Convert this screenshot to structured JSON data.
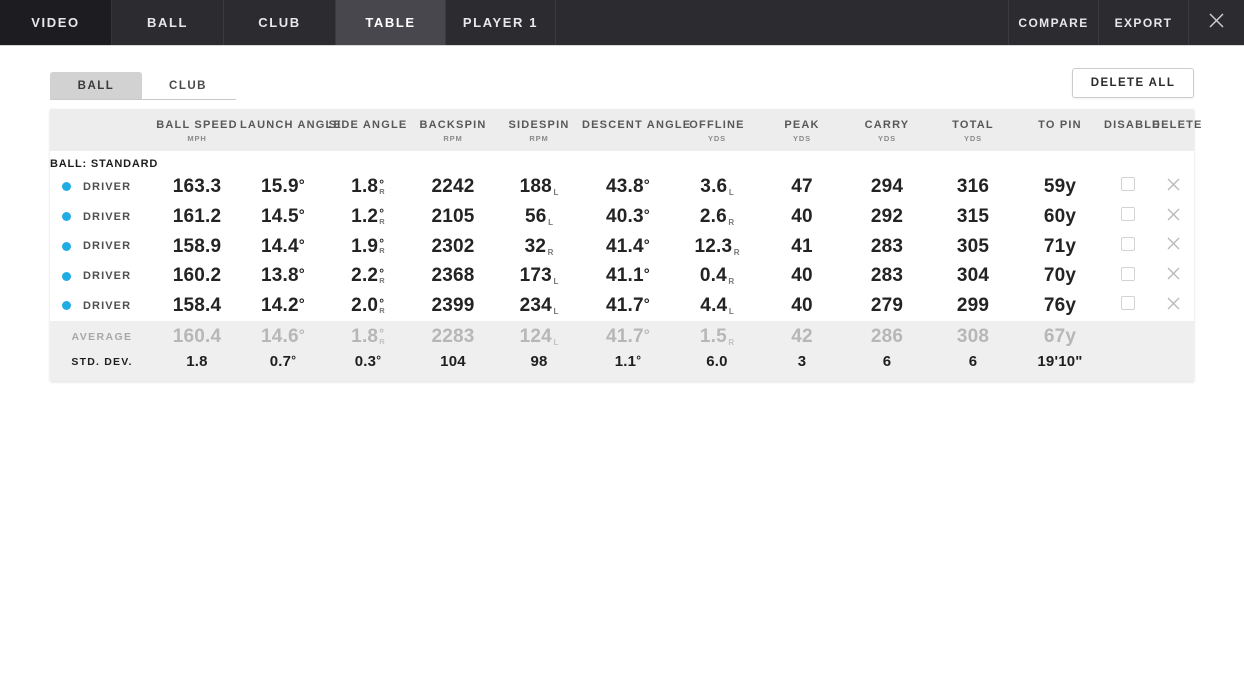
{
  "topnav": {
    "tabs": [
      {
        "label": "VIDEO",
        "active": false
      },
      {
        "label": "BALL",
        "active": false
      },
      {
        "label": "CLUB",
        "active": false
      },
      {
        "label": "TABLE",
        "active": true
      },
      {
        "label": "PLAYER 1",
        "active": false
      }
    ],
    "compare_label": "COMPARE",
    "export_label": "EXPORT",
    "close_icon": "close-icon"
  },
  "subtabs": [
    {
      "label": "BALL",
      "active": true
    },
    {
      "label": "CLUB",
      "active": false
    }
  ],
  "delete_all_label": "DELETE ALL",
  "table": {
    "headers": [
      {
        "label": "",
        "unit": ""
      },
      {
        "label": "BALL SPEED",
        "unit": "MPH"
      },
      {
        "label": "LAUNCH ANGLE",
        "unit": ""
      },
      {
        "label": "SIDE ANGLE",
        "unit": ""
      },
      {
        "label": "BACKSPIN",
        "unit": "RPM"
      },
      {
        "label": "SIDESPIN",
        "unit": "RPM"
      },
      {
        "label": "DESCENT ANGLE",
        "unit": ""
      },
      {
        "label": "OFFLINE",
        "unit": "YDS"
      },
      {
        "label": "PEAK",
        "unit": "YDS"
      },
      {
        "label": "CARRY",
        "unit": "YDS"
      },
      {
        "label": "TOTAL",
        "unit": "YDS"
      },
      {
        "label": "TO PIN",
        "unit": ""
      },
      {
        "label": "DISABLE",
        "unit": ""
      },
      {
        "label": "DELETE",
        "unit": ""
      }
    ],
    "group_label": "BALL: STANDARD",
    "dot_color": "#22ace4",
    "rows": [
      {
        "club": "DRIVER",
        "ball_speed": "163.3",
        "launch_angle": "15.9",
        "launch_deg": "°",
        "side_angle": "1.8",
        "side_deg": "°",
        "side_dir": "R",
        "backspin": "2242",
        "sidespin": "188",
        "sidespin_dir": "L",
        "descent_angle": "43.8",
        "descent_deg": "°",
        "offline": "3.6",
        "offline_dir": "L",
        "peak": "47",
        "carry": "294",
        "total": "316",
        "to_pin": "59y"
      },
      {
        "club": "DRIVER",
        "ball_speed": "161.2",
        "launch_angle": "14.5",
        "launch_deg": "°",
        "side_angle": "1.2",
        "side_deg": "°",
        "side_dir": "R",
        "backspin": "2105",
        "sidespin": "56",
        "sidespin_dir": "L",
        "descent_angle": "40.3",
        "descent_deg": "°",
        "offline": "2.6",
        "offline_dir": "R",
        "peak": "40",
        "carry": "292",
        "total": "315",
        "to_pin": "60y"
      },
      {
        "club": "DRIVER",
        "ball_speed": "158.9",
        "launch_angle": "14.4",
        "launch_deg": "°",
        "side_angle": "1.9",
        "side_deg": "°",
        "side_dir": "R",
        "backspin": "2302",
        "sidespin": "32",
        "sidespin_dir": "R",
        "descent_angle": "41.4",
        "descent_deg": "°",
        "offline": "12.3",
        "offline_dir": "R",
        "peak": "41",
        "carry": "283",
        "total": "305",
        "to_pin": "71y"
      },
      {
        "club": "DRIVER",
        "ball_speed": "160.2",
        "launch_angle": "13.8",
        "launch_deg": "°",
        "side_angle": "2.2",
        "side_deg": "°",
        "side_dir": "R",
        "backspin": "2368",
        "sidespin": "173",
        "sidespin_dir": "L",
        "descent_angle": "41.1",
        "descent_deg": "°",
        "offline": "0.4",
        "offline_dir": "R",
        "peak": "40",
        "carry": "283",
        "total": "304",
        "to_pin": "70y"
      },
      {
        "club": "DRIVER",
        "ball_speed": "158.4",
        "launch_angle": "14.2",
        "launch_deg": "°",
        "side_angle": "2.0",
        "side_deg": "°",
        "side_dir": "R",
        "backspin": "2399",
        "sidespin": "234",
        "sidespin_dir": "L",
        "descent_angle": "41.7",
        "descent_deg": "°",
        "offline": "4.4",
        "offline_dir": "L",
        "peak": "40",
        "carry": "279",
        "total": "299",
        "to_pin": "76y"
      }
    ],
    "average": {
      "label": "AVERAGE",
      "ball_speed": "160.4",
      "launch_angle": "14.6",
      "launch_deg": "°",
      "side_angle": "1.8",
      "side_deg": "°",
      "side_dir": "R",
      "backspin": "2283",
      "sidespin": "124",
      "sidespin_dir": "L",
      "descent_angle": "41.7",
      "descent_deg": "°",
      "offline": "1.5",
      "offline_dir": "R",
      "peak": "42",
      "carry": "286",
      "total": "308",
      "to_pin": "67y"
    },
    "std_dev": {
      "label": "STD. DEV.",
      "ball_speed": "1.8",
      "launch_angle": "0.7",
      "launch_deg": "°",
      "side_angle": "0.3",
      "side_deg": "°",
      "backspin": "104",
      "sidespin": "98",
      "descent_angle": "1.1",
      "descent_deg": "°",
      "offline": "6.0",
      "peak": "3",
      "carry": "6",
      "total": "6",
      "to_pin": "19'10\""
    }
  }
}
